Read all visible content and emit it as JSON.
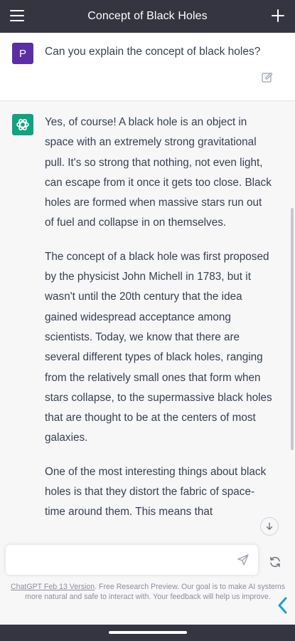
{
  "header": {
    "title": "Concept of Black Holes",
    "menu_icon": "hamburger-menu-icon",
    "new_chat_icon": "plus-icon"
  },
  "user_message": {
    "avatar_letter": "P",
    "text": "Can you explain the concept of black holes?",
    "edit_icon": "edit-icon"
  },
  "assistant_message": {
    "paragraphs": [
      "Yes, of course! A black hole is an object in space with an extremely strong gravitational pull. It's so strong that nothing, not even light, can escape from it once it gets too close. Black holes are formed when massive stars run out of fuel and collapse in on themselves.",
      "The concept of a black hole was first proposed by the physicist John Michell in 1783, but it wasn't until the 20th century that the idea gained widespread acceptance among scientists. Today, we know that there are several different types of black holes, ranging from the relatively small ones that form when stars collapse, to the supermassive black holes that are thought to be at the centers of most galaxies.",
      "One of the most interesting things about black holes is that they distort the fabric of space-time around them. This means that"
    ]
  },
  "composer": {
    "input_value": "",
    "input_placeholder": "",
    "send_icon": "send-icon",
    "regenerate_icon": "refresh-icon"
  },
  "footer": {
    "version_link": "ChatGPT Feb 13 Version",
    "note": ". Free Research Preview. Our goal is to make AI systems more natural and safe to interact with. Your feedback will help us improve."
  },
  "colors": {
    "header_bg": "#343541",
    "user_avatar": "#5b2ea6",
    "assistant_avatar": "#10a37f",
    "chevron": "#19a2c6"
  }
}
